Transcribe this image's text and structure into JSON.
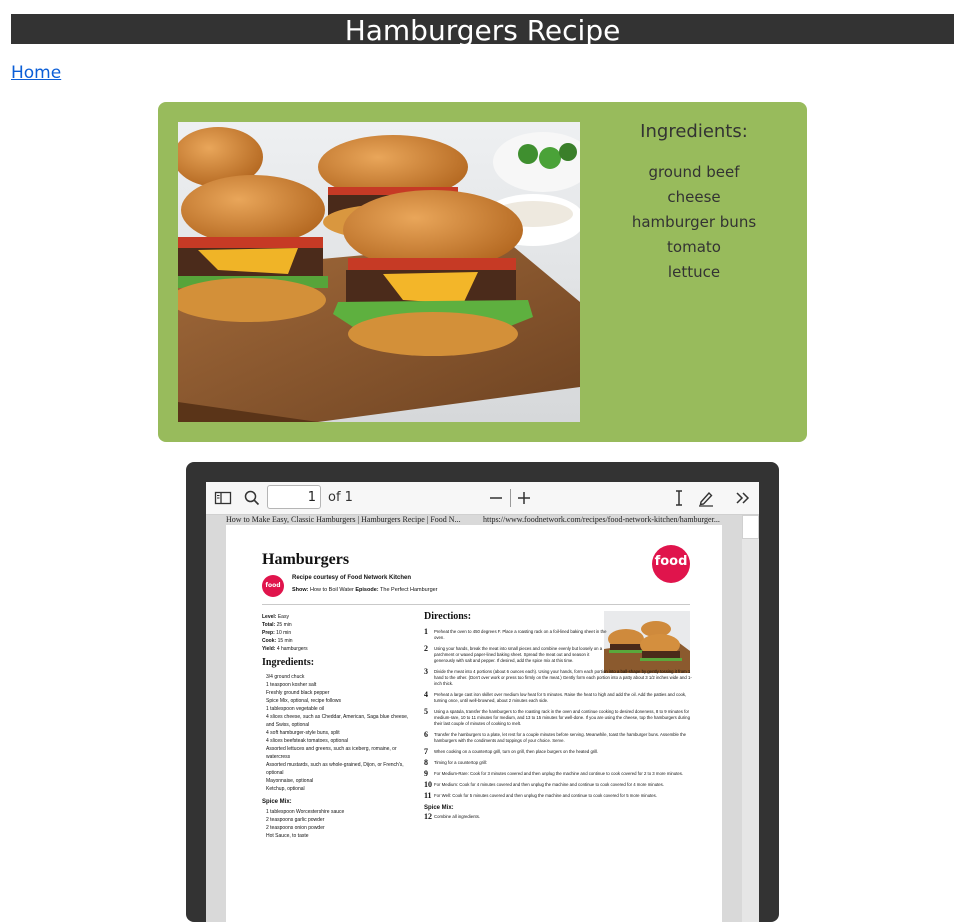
{
  "header": {
    "title": "Hamburgers Recipe"
  },
  "nav": {
    "home_label": "Home"
  },
  "ingredients": {
    "title": "Ingredients:",
    "items": [
      "ground beef",
      "cheese",
      "hamburger buns",
      "tomato",
      "lettuce"
    ]
  },
  "pdf_viewer": {
    "page_number": "1",
    "page_total_label": "of 1",
    "header_left": "How to Make Easy, Classic Hamburgers | Hamburgers Recipe | Food N...",
    "header_right": "https://www.foodnetwork.com/recipes/food-network-kitchen/hamburger...",
    "icons": [
      "sidebar-toggle-icon",
      "search-icon",
      "zoom-out-icon",
      "zoom-in-icon",
      "text-select-icon",
      "draw-icon",
      "more-tools-icon"
    ]
  },
  "document": {
    "title": "Hamburgers",
    "logo_text": "food",
    "logo_small_text": "food",
    "courtesy": "Recipe courtesy of Food Network Kitchen",
    "show_label": "Show:",
    "show_value": "How to Boil Water",
    "episode_label": "Episode:",
    "episode_value": "The Perfect Hamburger",
    "meta": [
      {
        "label": "Level:",
        "value": "Easy"
      },
      {
        "label": "Total:",
        "value": "25 min"
      },
      {
        "label": "Prep:",
        "value": "10 min"
      },
      {
        "label": "Cook:",
        "value": "15 min"
      },
      {
        "label": "Yield:",
        "value": "4 hamburgers"
      }
    ],
    "ingredients_title": "Ingredients:",
    "ingredients": [
      "3/4 ground chuck",
      "1 teaspoon kosher salt",
      "Freshly ground black pepper",
      "Spice Mix, optional, recipe follows",
      "1 tablespoon vegetable oil",
      "4 slices cheese, such as Cheddar, American, Saga blue cheese, and Swiss, optional",
      "4 soft hamburger-style buns, split",
      "4 slices beefsteak tomatoes, optional",
      "Assorted lettuces and greens, such as iceberg, romaine, or watercress",
      "Assorted mustards, such as whole-grained, Dijon, or French's, optional",
      "Mayonnaise, optional",
      "Ketchup, optional"
    ],
    "spice_title": "Spice Mix:",
    "spice": [
      "1 tablespoon Worcestershire sauce",
      "2 teaspoons garlic powder",
      "2 teaspoons onion powder",
      "Hot Sauce, to taste"
    ],
    "directions_title": "Directions:",
    "steps": [
      {
        "n": "1",
        "text": "Preheat the oven to 450 degrees F. Place a roasting rack on a foil-lined baking sheet in the oven."
      },
      {
        "n": "2",
        "text": "Using your hands, break the meat into small pieces and combine evenly but loosely on a parchment or waxed paper-lined baking sheet. Spread the meat out and season it generously with salt and pepper. If desired, add the spice mix at this time."
      },
      {
        "n": "3",
        "text": "Divide the meat into 4 portions (about 6 ounces each). Using your hands, form each portion into a ball-shape by gently tossing it from 1 hand to the other. (Don't over work or press too firmly on the meat.) Gently form each portion into a patty about 3 1/2 inches wide and 1-inch thick."
      },
      {
        "n": "4",
        "text": "Preheat a large cast iron skillet over medium low heat for 5 minutes. Raise the heat to high and add the oil. Add the patties and cook, turning once, until well-browned, about 2 minutes each side."
      },
      {
        "n": "5",
        "text": "Using a spatula, transfer the hamburgers to the roasting rack in the oven and continue cooking to desired doneness, 8 to 9 minutes for medium-rare, 10 to 11 minutes for medium, and 13 to 15 minutes for well-done. If you are using the cheese, top the hamburgers during their last couple of minutes of cooking to melt."
      },
      {
        "n": "6",
        "text": "Transfer the hamburgers to a plate, let rest for a couple minutes before serving. Meanwhile, toast the hamburger buns. Assemble the hamburgers with the condiments and toppings of your choice. Serve."
      },
      {
        "n": "7",
        "text": "When cooking on a countertop grill, turn on grill, then place burgers on the heated grill."
      },
      {
        "n": "8",
        "text": "Timing for a countertop grill:"
      },
      {
        "n": "9",
        "text": "For Medium-Rare: Cook for 3 minutes covered and then unplug the machine and continue to cook covered for 2 to 3 more minutes."
      },
      {
        "n": "10",
        "text": "For Medium: Cook for 4 minutes covered and then unplug the machine and continue to cook covered for 4 more minutes."
      },
      {
        "n": "11",
        "text": "For Well: Cook for 5 minutes covered and then unplug the machine and continue to cook covered for 5 more minutes."
      }
    ],
    "spice_directions_title": "Spice Mix:",
    "spice_step": {
      "n": "12",
      "text": "Combine all ingredients."
    }
  },
  "colors": {
    "banner": "#333333",
    "card": "#98bb5c",
    "link": "#0b5ed7",
    "brand_red": "#e0144c"
  }
}
